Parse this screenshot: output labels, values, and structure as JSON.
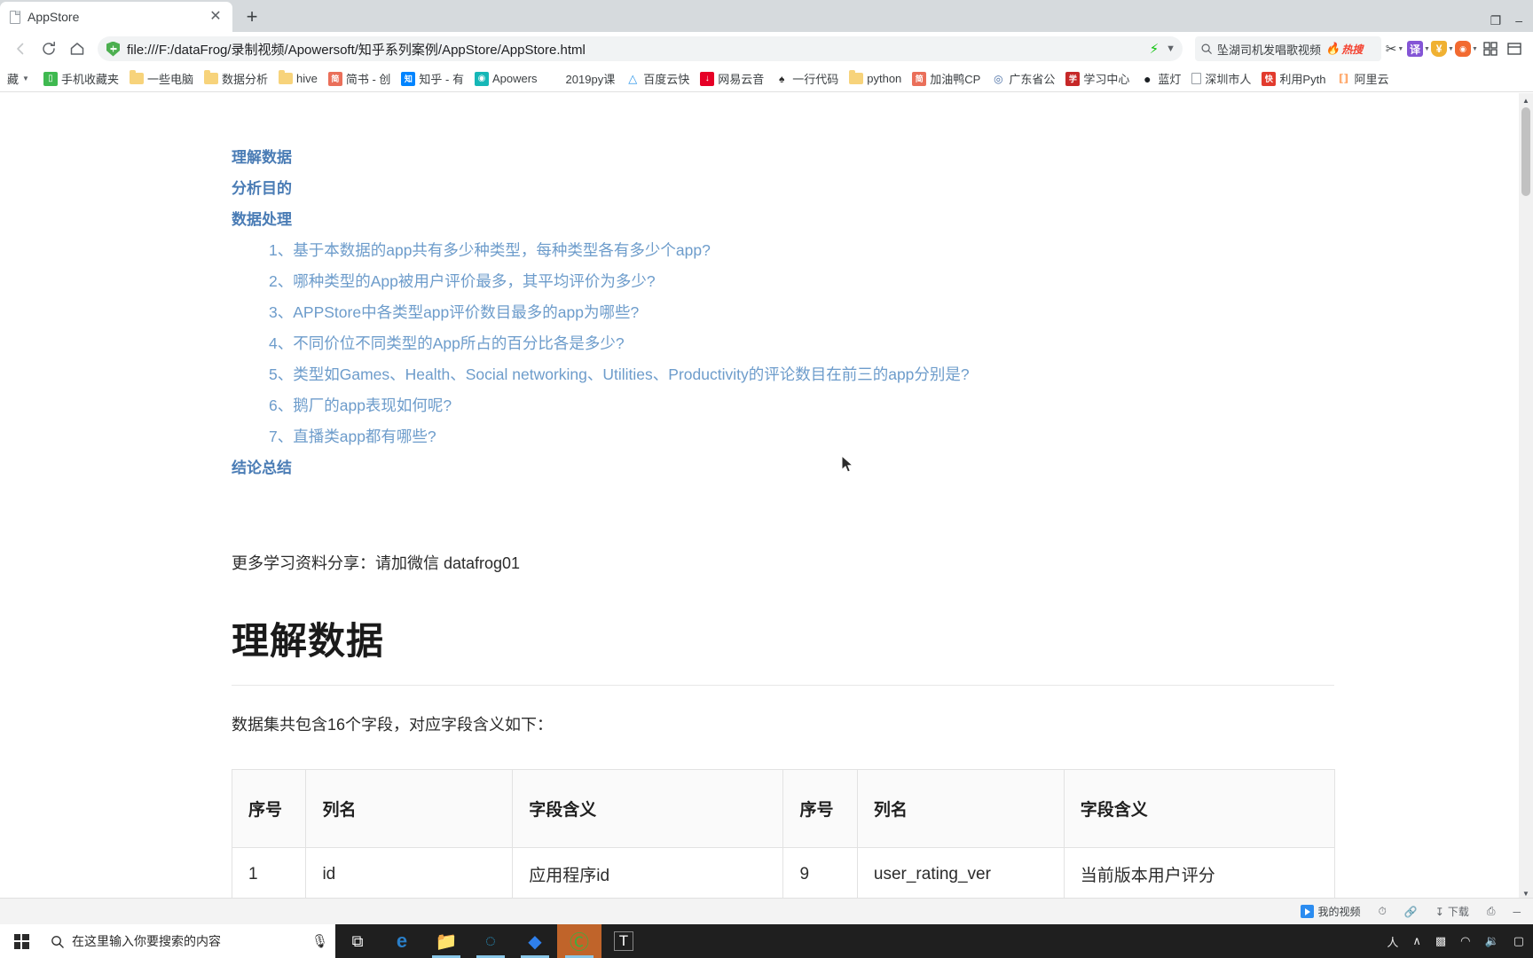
{
  "browser": {
    "tab": {
      "title": "AppStore",
      "favicon_icon": "page-icon",
      "close_icon": "close-icon"
    },
    "new_tab_label": "+",
    "window_controls": {
      "restore": "❐",
      "minimize": "–"
    },
    "toolbar": {
      "back_icon": "back-arrow-icon",
      "forward_icon": "forward-arrow-icon",
      "reload_icon": "reload-icon",
      "home_icon": "home-icon",
      "url": "file:///F:/dataFrog/录制视频/Apowersoft/知乎系列案例/AppStore/AppStore.html",
      "security_icon": "shield-icon",
      "bolt_icon": "lightning-icon",
      "chevron_icon": "chevron-down-icon"
    },
    "search": {
      "icon": "search-icon",
      "query": "坠湖司机发唱歌视频",
      "badge": "热搜",
      "badge_icon": "flame-icon"
    },
    "extensions": [
      {
        "name": "scissors-icon",
        "glyph": "✂",
        "color": "#3c4043",
        "bg": "transparent",
        "caret": true
      },
      {
        "name": "translate-icon",
        "glyph": "译",
        "color": "#ffffff",
        "bg": "#8455d6",
        "caret": true
      },
      {
        "name": "shield-badge-icon",
        "glyph": "¥",
        "color": "#ffffff",
        "bg": "#f0b132",
        "caret": true
      },
      {
        "name": "gamepad-icon",
        "glyph": "◓",
        "color": "#ffffff",
        "bg": "#f26a30",
        "caret": true
      },
      {
        "name": "grid-apps-icon",
        "glyph": "∷",
        "color": "#3c4043",
        "bg": "transparent",
        "caret": false
      },
      {
        "name": "menu-icon",
        "glyph": "▤",
        "color": "#3c4043",
        "bg": "transparent",
        "caret": false
      }
    ],
    "bookmarks": {
      "overflow_label": "藏",
      "caret_icon": "chevron-down-icon",
      "items": [
        {
          "label": "手机收藏夹",
          "icon": "phone-icon",
          "glyph": "▯",
          "bg": "#3fb950"
        },
        {
          "label": "一些电脑",
          "icon": "folder-icon",
          "glyph": "",
          "bg": "folder"
        },
        {
          "label": "数据分析",
          "icon": "folder-icon",
          "glyph": "",
          "bg": "folder"
        },
        {
          "label": "hive",
          "icon": "folder-icon",
          "glyph": "",
          "bg": "folder"
        },
        {
          "label": "简书 - 创",
          "icon": "jianshu-icon",
          "glyph": "简",
          "bg": "#ea6f5a"
        },
        {
          "label": "知乎 - 有",
          "icon": "zhihu-icon",
          "glyph": "知",
          "bg": "#0084ff"
        },
        {
          "label": "Apowers",
          "icon": "apowersoft-icon",
          "glyph": "◉",
          "bg": "#16b7b7"
        },
        {
          "label": "2019py课",
          "icon": "python-site-icon",
          "glyph": "ฤ",
          "bg": "transparent"
        },
        {
          "label": "百度云快",
          "icon": "baidu-cloud-icon",
          "glyph": "△",
          "bg": "transparent"
        },
        {
          "label": "网易云音",
          "icon": "netease-music-icon",
          "glyph": "↓",
          "bg": "#e60026"
        },
        {
          "label": "一行代码",
          "icon": "code-icon",
          "glyph": "♠",
          "bg": "transparent"
        },
        {
          "label": "python",
          "icon": "folder-icon",
          "glyph": "",
          "bg": "folder"
        },
        {
          "label": "加油鸭CP",
          "icon": "jianshu-icon",
          "glyph": "简",
          "bg": "#ea6f5a"
        },
        {
          "label": "广东省公",
          "icon": "gov-icon",
          "glyph": "◎",
          "bg": "transparent"
        },
        {
          "label": "学习中心",
          "icon": "study-center-icon",
          "glyph": "学",
          "bg": "#c62828"
        },
        {
          "label": "蓝灯",
          "icon": "github-icon",
          "glyph": "●",
          "bg": "transparent"
        },
        {
          "label": "深圳市人",
          "icon": "page-icon",
          "glyph": "",
          "bg": "page"
        },
        {
          "label": "利用Pyth",
          "icon": "book-icon",
          "glyph": "快",
          "bg": "#e23b2e"
        },
        {
          "label": "阿里云",
          "icon": "aliyun-icon",
          "glyph": "⟦·⟧",
          "bg": "transparent"
        }
      ]
    }
  },
  "page": {
    "toc": [
      {
        "label": "理解数据",
        "type": "heading"
      },
      {
        "label": "分析目的",
        "type": "heading"
      },
      {
        "label": "数据处理",
        "type": "heading"
      }
    ],
    "toc_sub": [
      "1、基于本数据的app共有多少种类型，每种类型各有多少个app?",
      "2、哪种类型的App被用户评价最多，其平均评价为多少?",
      "3、APPStore中各类型app评价数目最多的app为哪些?",
      "4、不同价位不同类型的App所占的百分比各是多少?",
      "5、类型如Games、Health、Social networking、Utilities、Productivity的评论数目在前三的app分别是?",
      "6、鹅厂的app表现如何呢?",
      "7、直播类app都有哪些?"
    ],
    "toc_last": "结论总结",
    "wechat_line": "更多学习资料分享：请加微信 datafrog01",
    "h1": "理解数据",
    "desc": "数据集共包含16个字段，对应字段含义如下：",
    "table": {
      "headers": [
        "序号",
        "列名",
        "字段含义",
        "序号",
        "列名",
        "字段含义"
      ],
      "rows": [
        [
          "1",
          "id",
          "应用程序id",
          "9",
          "user_rating_ver",
          "当前版本用户评分"
        ]
      ]
    }
  },
  "player_bar": {
    "my_video_label": "我的视频",
    "my_video_icon": "play-icon",
    "items": [
      {
        "label": "",
        "icon": "clock-icon",
        "glyph": "◴"
      },
      {
        "label": "",
        "icon": "link-icon",
        "glyph": "⚭"
      },
      {
        "label": "下载",
        "icon": "download-icon",
        "glyph": "⤓"
      },
      {
        "label": "",
        "icon": "printer-icon",
        "glyph": "⎙"
      },
      {
        "label": "",
        "icon": "minimize-icon",
        "glyph": "―"
      }
    ]
  },
  "taskbar": {
    "start_icon": "windows-logo-icon",
    "search_placeholder": "在这里输入你要搜索的内容",
    "search_icon": "search-circle-icon",
    "mic_icon": "microphone-icon",
    "apps": [
      {
        "name": "task-view-icon",
        "glyph": "⧉",
        "color": "#ffffff",
        "active": false,
        "underline": false
      },
      {
        "name": "edge-icon",
        "glyph": "e",
        "color": "#2a7fc9",
        "active": false,
        "underline": false
      },
      {
        "name": "file-explorer-icon",
        "glyph": "▤",
        "color": "#f5c14e",
        "active": false,
        "underline": true
      },
      {
        "name": "browser-360-icon",
        "glyph": "◔",
        "color": "#2aa7dd",
        "active": false,
        "underline": true
      },
      {
        "name": "app-blue-icon",
        "glyph": "◢",
        "color": "#2f80ed",
        "active": false,
        "underline": true
      },
      {
        "name": "sogou-browser-icon",
        "glyph": "Ⓔ",
        "color": "#3eae3e",
        "active": true,
        "underline": true
      },
      {
        "name": "typora-icon",
        "glyph": "T",
        "color": "#ffffff",
        "active": false,
        "underline": false
      }
    ],
    "tray": [
      {
        "name": "ime-icon",
        "glyph": "人"
      },
      {
        "name": "chevron-up-icon",
        "glyph": "∧"
      },
      {
        "name": "battery-icon",
        "glyph": "▭"
      },
      {
        "name": "wifi-icon",
        "glyph": "◠"
      },
      {
        "name": "volume-icon",
        "glyph": "◂)"
      },
      {
        "name": "notification-icon",
        "glyph": "□"
      }
    ]
  },
  "colors": {
    "link_blue": "#4a7cb5",
    "sublink_blue": "#6d9ccb",
    "accent_green": "#4caf50",
    "hot_red": "#f4402e",
    "taskbar_dark": "#1f1f1f",
    "active_orange": "#c0642a"
  }
}
